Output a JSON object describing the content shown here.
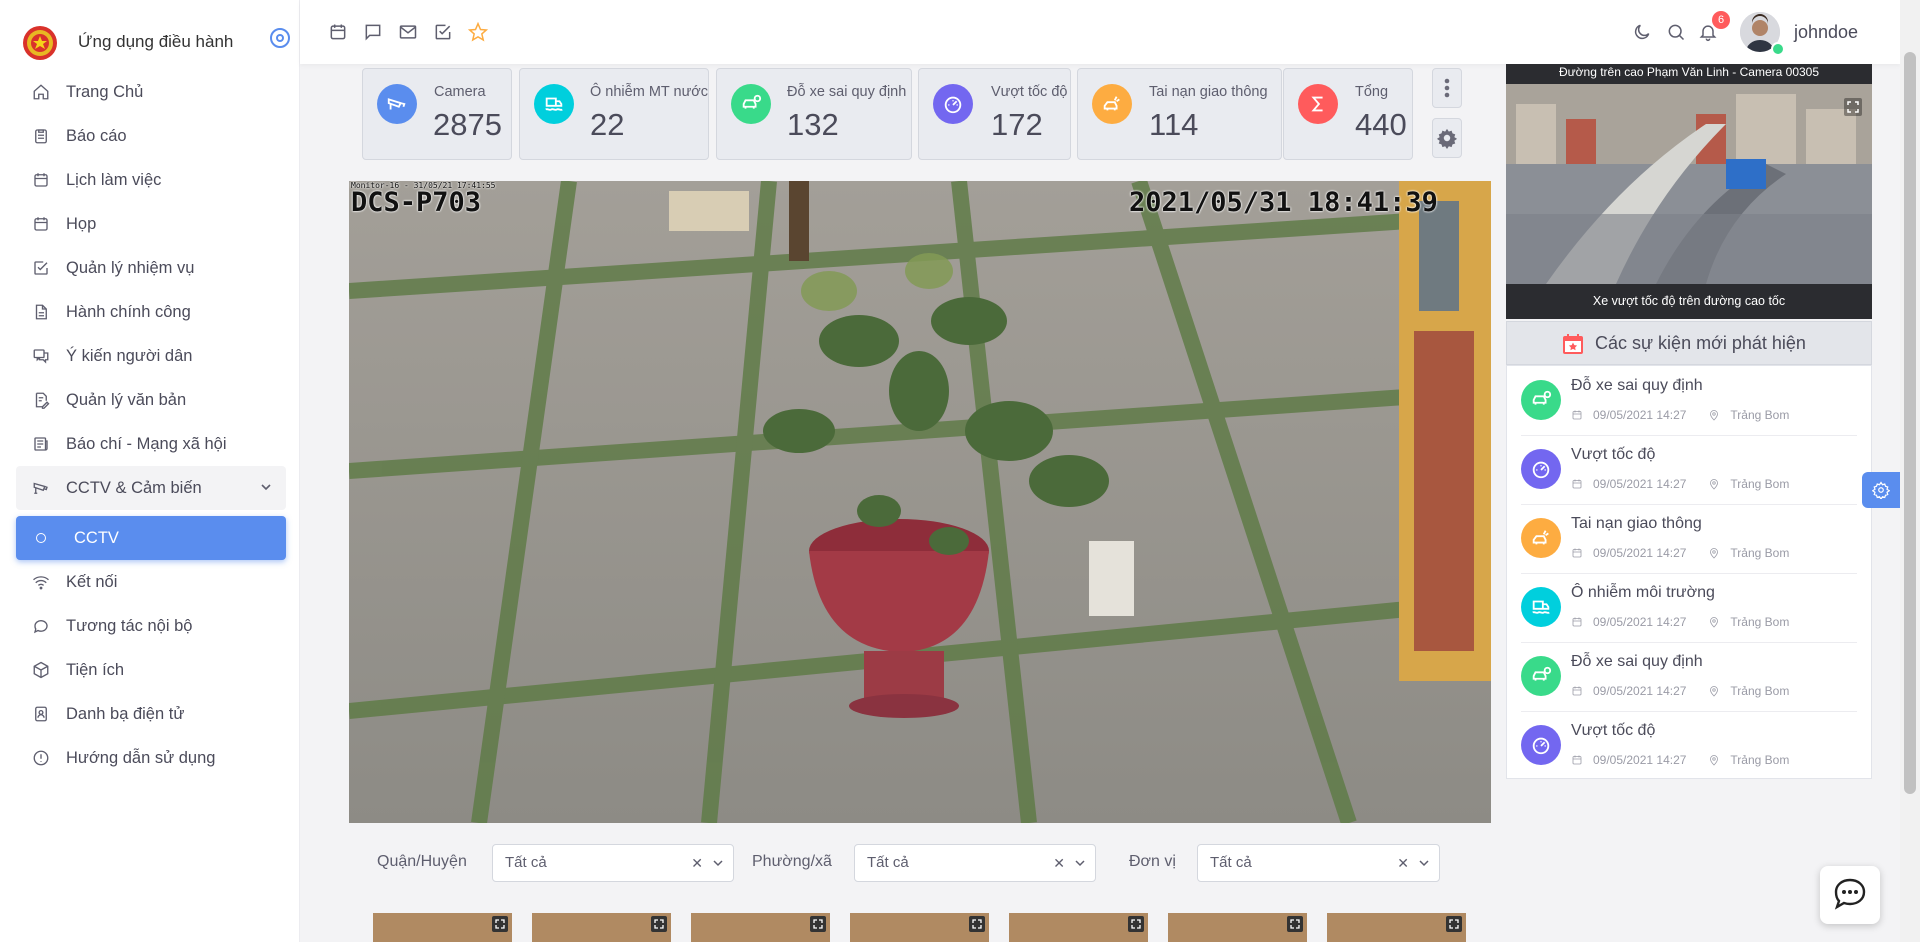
{
  "app": {
    "title": "Ứng dụng điều hành"
  },
  "sidebar": {
    "items": [
      {
        "label": "Trang Chủ",
        "icon": "home-icon"
      },
      {
        "label": "Báo cáo",
        "icon": "clipboard-icon"
      },
      {
        "label": "Lịch làm việc",
        "icon": "calendar-icon"
      },
      {
        "label": "Họp",
        "icon": "calendar-icon"
      },
      {
        "label": "Quản lý nhiệm vụ",
        "icon": "check-square-icon"
      },
      {
        "label": "Hành chính công",
        "icon": "file-icon"
      },
      {
        "label": "Ý kiến người dân",
        "icon": "comments-icon"
      },
      {
        "label": "Quản lý văn bản",
        "icon": "file-edit-icon"
      },
      {
        "label": "Báo chí - Mạng xã hội",
        "icon": "newspaper-icon"
      }
    ],
    "group": {
      "label": "CCTV & Cảm biến",
      "icon": "cctv-icon"
    },
    "active_sub": {
      "label": "CCTV"
    },
    "items_after": [
      {
        "label": "Kết nối",
        "icon": "wifi-icon"
      },
      {
        "label": "Tương tác nội bộ",
        "icon": "chat-icon"
      },
      {
        "label": "Tiện ích",
        "icon": "box-icon"
      },
      {
        "label": "Danh bạ điện tử",
        "icon": "contacts-icon"
      },
      {
        "label": "Hướng dẫn sử dụng",
        "icon": "info-icon"
      }
    ]
  },
  "topbar": {
    "notifications": "6",
    "username": "johndoe"
  },
  "stats": [
    {
      "label": "Camera",
      "value": "2875",
      "color": "#5a8dee",
      "icon": "camera-icon"
    },
    {
      "label": "Ô nhiễm MT nước",
      "value": "22",
      "color": "#00cfdd",
      "icon": "water-icon"
    },
    {
      "label": "Đỗ xe sai quy định",
      "value": "132",
      "color": "#39da8a",
      "icon": "car-icon"
    },
    {
      "label": "Vượt tốc độ",
      "value": "172",
      "color": "#7367f0",
      "icon": "speedometer-icon"
    },
    {
      "label": "Tai nạn giao thông",
      "value": "114",
      "color": "#fdac41",
      "icon": "accident-icon"
    },
    {
      "label": "Tổng",
      "value": "440",
      "color": "#ff5b5c",
      "icon": "sigma-icon"
    }
  ],
  "video": {
    "osd_small": "Monitor-16 - 31/05/21 17:41:55",
    "osd_name": "DCS-P703",
    "osd_time": "2021/05/31 18:41:39"
  },
  "filters": [
    {
      "label": "Quận/Huyện",
      "value": "Tất cả"
    },
    {
      "label": "Phường/xã",
      "value": "Tất cả"
    },
    {
      "label": "Đơn vị",
      "value": "Tất cả"
    }
  ],
  "featured": {
    "top_caption": "Đường trên cao Phạm Văn Linh - Camera 00305",
    "bottom_caption": "Xe vượt tốc độ trên đường cao tốc"
  },
  "events_title": "Các sự kiện mới phát hiện",
  "events": [
    {
      "title": "Đỗ xe sai quy định",
      "time": "09/05/2021 14:27",
      "place": "Trảng Bom",
      "color": "#39da8a",
      "icon": "car-icon"
    },
    {
      "title": "Vượt tốc độ",
      "time": "09/05/2021 14:27",
      "place": "Trảng Bom",
      "color": "#7367f0",
      "icon": "speedometer-icon"
    },
    {
      "title": "Tai nạn giao thông",
      "time": "09/05/2021 14:27",
      "place": "Trảng Bom",
      "color": "#fdac41",
      "icon": "accident-icon"
    },
    {
      "title": "Ô nhiễm môi trường",
      "time": "09/05/2021 14:27",
      "place": "Trảng Bom",
      "color": "#00cfdd",
      "icon": "water-icon"
    },
    {
      "title": "Đỗ xe sai quy định",
      "time": "09/05/2021 14:27",
      "place": "Trảng Bom",
      "color": "#39da8a",
      "icon": "car-icon"
    },
    {
      "title": "Vượt tốc độ",
      "time": "09/05/2021 14:27",
      "place": "Trảng Bom",
      "color": "#7367f0",
      "icon": "speedometer-icon"
    }
  ]
}
